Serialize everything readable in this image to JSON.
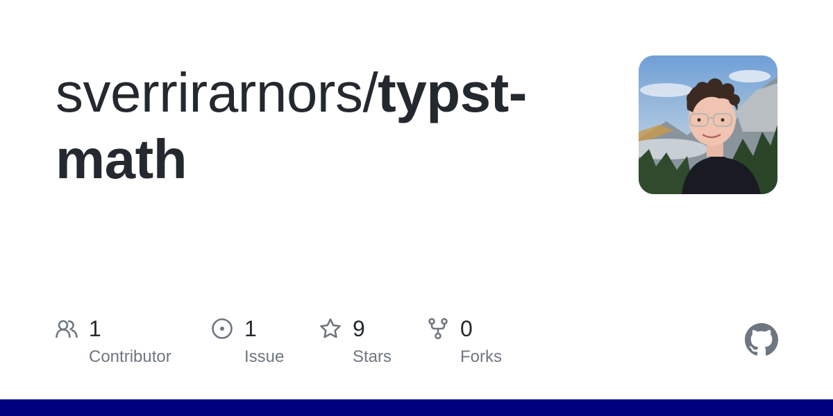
{
  "repo": {
    "owner": "sverrirarnors/",
    "name": "typst-math"
  },
  "stats": [
    {
      "icon": "people-icon",
      "count": "1",
      "label": "Contributor"
    },
    {
      "icon": "issue-opened-icon",
      "count": "1",
      "label": "Issue"
    },
    {
      "icon": "star-icon",
      "count": "9",
      "label": "Stars"
    },
    {
      "icon": "repo-forked-icon",
      "count": "0",
      "label": "Forks"
    }
  ],
  "colors": {
    "text": "#24292f",
    "muted": "#6e7781",
    "bar": "#00007f"
  }
}
